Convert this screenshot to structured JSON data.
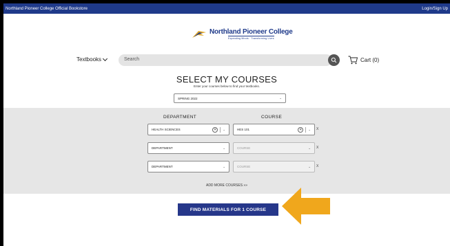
{
  "topbar": {
    "title": "Northland Pioneer College Official Bookstore",
    "login": "Login/Sign Up"
  },
  "logo": {
    "name": "Northland Pioneer College",
    "tagline": "Expanding Minds · Transforming Lives"
  },
  "nav": {
    "textbooks": "Textbooks",
    "search_placeholder": "Search",
    "cart": "Cart (0)"
  },
  "main": {
    "title": "SELECT MY COURSES",
    "subtitle": "Enter your courses below to find your textbooks.",
    "term": "SPRING 2022"
  },
  "table": {
    "department_header": "DEPARTMENT",
    "course_header": "COURSE",
    "rows": [
      {
        "department": "HEALTH SCIENCES",
        "course": "HES 101",
        "remove": "X"
      },
      {
        "department": "DEPARTMENT",
        "course": "COURSE",
        "remove": "X"
      },
      {
        "department": "DEPARTMENT",
        "course": "COURSE",
        "remove": "X"
      }
    ]
  },
  "add_more": "ADD MORE COURSES »»",
  "find_button": "FIND MATERIALS FOR 1 COURSE",
  "colors": {
    "brand_blue": "#1f3a8a",
    "button_blue": "#26378a",
    "arrow_orange": "#f0a71c"
  },
  "icons": [
    "search-icon",
    "cart-icon",
    "chevron-down-icon",
    "clear-icon",
    "arrow-left-icon",
    "logo-emblem-icon"
  ]
}
